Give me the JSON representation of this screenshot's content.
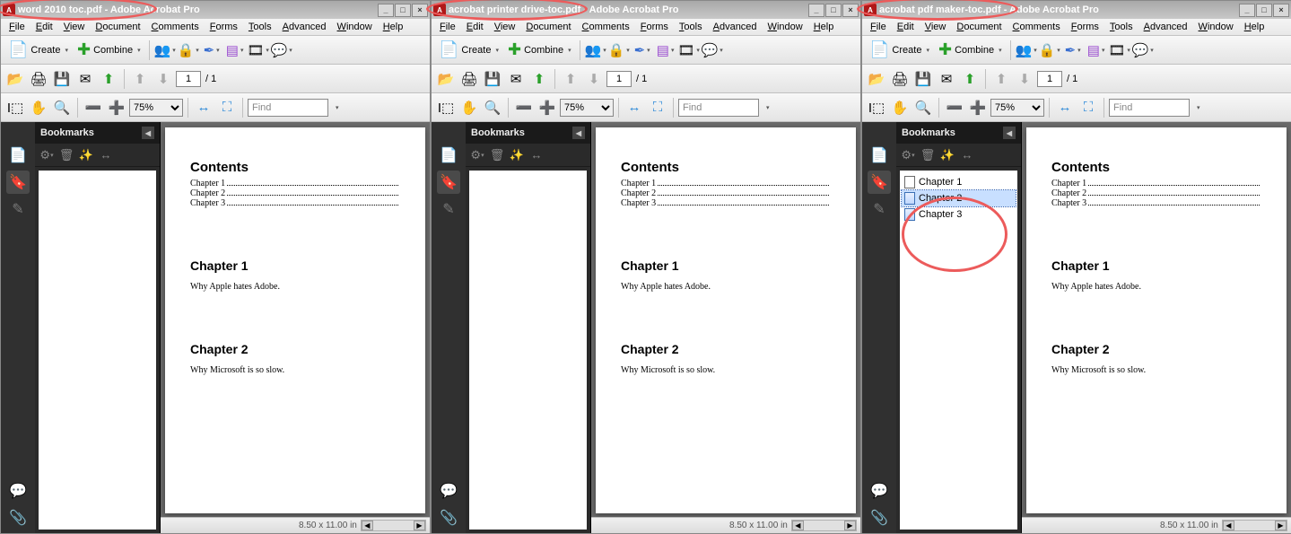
{
  "app_suffix": " - Adobe Acrobat Pro",
  "menus": [
    "File",
    "Edit",
    "View",
    "Document",
    "Comments",
    "Forms",
    "Tools",
    "Advanced",
    "Window",
    "Help"
  ],
  "toolbar_labels": {
    "create": "Create",
    "combine": "Combine"
  },
  "page_current": "1",
  "page_total": "1",
  "zoom": "75%",
  "find_placeholder": "Find",
  "bookmarks_title": "Bookmarks",
  "status_dimensions": "8.50 x 11.00 in",
  "doc": {
    "toc_title": "Contents",
    "toc_items": [
      "Chapter 1",
      "Chapter 2",
      "Chapter 3"
    ],
    "chapters": [
      {
        "title": "Chapter 1",
        "body": "Why Apple hates Adobe."
      },
      {
        "title": "Chapter 2",
        "body": "Why Microsoft is so slow."
      }
    ]
  },
  "windows": [
    {
      "filename": "word 2010 toc.pdf",
      "bookmarks": [],
      "circle_title": true,
      "circle_bookmarks": false
    },
    {
      "filename": "acrobat printer drive-toc.pdf",
      "bookmarks": [],
      "circle_title": true,
      "circle_bookmarks": false
    },
    {
      "filename": "acrobat pdf maker-toc.pdf",
      "bookmarks": [
        {
          "label": "Chapter 1",
          "selected": false,
          "blue": false
        },
        {
          "label": "Chapter 2",
          "selected": true,
          "blue": true
        },
        {
          "label": "Chapter 3",
          "selected": false,
          "blue": true
        }
      ],
      "circle_title": true,
      "circle_bookmarks": true
    }
  ]
}
